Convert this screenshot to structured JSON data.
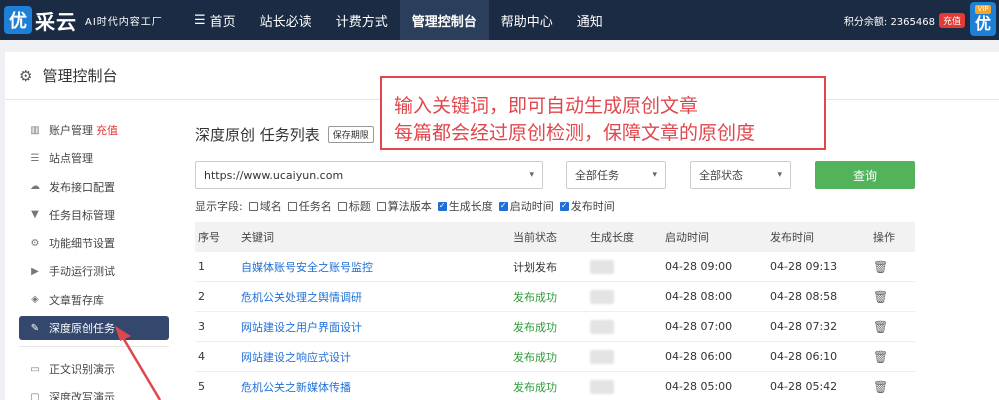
{
  "brand": {
    "logo_char": "优",
    "name": "采云",
    "tagline": "AI时代内容工厂"
  },
  "nav": [
    {
      "label": "首页",
      "icon": "menu-icon"
    },
    {
      "label": "站长必读"
    },
    {
      "label": "计费方式"
    },
    {
      "label": "管理控制台",
      "active": true
    },
    {
      "label": "帮助中心"
    },
    {
      "label": "通知"
    }
  ],
  "account": {
    "points_label": "积分余额: 2365468",
    "charge_label": "充值",
    "vip_tag": "VIP",
    "vip_char": "优"
  },
  "panel": {
    "title": "管理控制台"
  },
  "sidebar": [
    {
      "label": "账户管理",
      "extra": "充值",
      "icon": "bar-chart-icon"
    },
    {
      "label": "站点管理",
      "icon": "server-icon"
    },
    {
      "label": "发布接口配置",
      "icon": "cloud-upload-icon"
    },
    {
      "label": "任务目标管理",
      "icon": "filter-icon"
    },
    {
      "label": "功能细节设置",
      "icon": "cogs-icon"
    },
    {
      "label": "手动运行测试",
      "icon": "play-icon"
    },
    {
      "label": "文章暂存库",
      "icon": "layers-icon"
    },
    {
      "label": "深度原创任务",
      "icon": "edit-icon",
      "active": true
    },
    {
      "label": "正文识别演示",
      "icon": "monitor-icon"
    },
    {
      "label": "深度改写演示",
      "icon": "chat-icon"
    }
  ],
  "main": {
    "title": "深度原创 任务列表",
    "save_tag": "保存期限"
  },
  "filters": {
    "url_value": "https://www.ucaiyun.com",
    "task_select": "全部任务",
    "status_select": "全部状态",
    "query_label": "查询"
  },
  "fields": {
    "label": "显示字段:",
    "options": [
      {
        "label": "域名",
        "checked": false
      },
      {
        "label": "任务名",
        "checked": false
      },
      {
        "label": "标题",
        "checked": false
      },
      {
        "label": "算法版本",
        "checked": false
      },
      {
        "label": "生成长度",
        "checked": true
      },
      {
        "label": "启动时间",
        "checked": true
      },
      {
        "label": "发布时间",
        "checked": true
      }
    ]
  },
  "table": {
    "headers": [
      "序号",
      "关键词",
      "当前状态",
      "生成长度",
      "启动时间",
      "发布时间",
      "操作"
    ],
    "rows": [
      {
        "no": "1",
        "keyword": "自媒体账号安全之账号监控",
        "status": "计划发布",
        "status_type": "plan",
        "start": "04-28 09:00",
        "publish": "04-28 09:13"
      },
      {
        "no": "2",
        "keyword": "危机公关处理之舆情调研",
        "status": "发布成功",
        "status_type": "ok",
        "start": "04-28 08:00",
        "publish": "04-28 08:58"
      },
      {
        "no": "3",
        "keyword": "网站建设之用户界面设计",
        "status": "发布成功",
        "status_type": "ok",
        "start": "04-28 07:00",
        "publish": "04-28 07:32"
      },
      {
        "no": "4",
        "keyword": "网站建设之响应式设计",
        "status": "发布成功",
        "status_type": "ok",
        "start": "04-28 06:00",
        "publish": "04-28 06:10"
      },
      {
        "no": "5",
        "keyword": "危机公关之新媒体传播",
        "status": "发布成功",
        "status_type": "ok",
        "start": "04-28 05:00",
        "publish": "04-28 05:42"
      }
    ]
  },
  "callout": {
    "line1": "输入关键词，即可自动生成原创文章",
    "line2": "每篇都会经过原创检测，保障文章的原创度"
  },
  "colors": {
    "nav_bg": "#1b2b44",
    "accent_green": "#52b35a",
    "link_blue": "#1e6fd6",
    "annotation_red": "#e0474c",
    "sidebar_active": "#34486e"
  }
}
